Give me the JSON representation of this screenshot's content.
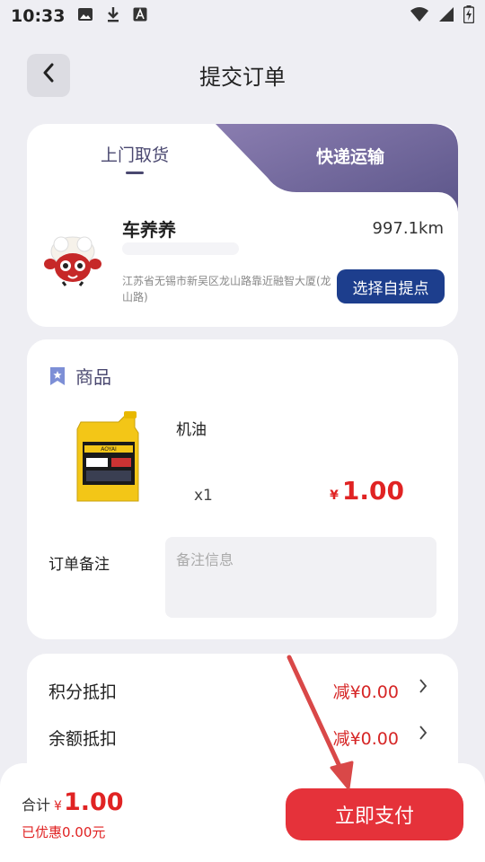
{
  "status": {
    "time": "10:33"
  },
  "header": {
    "title": "提交订单"
  },
  "delivery": {
    "tab_pickup": "上门取货",
    "tab_express": "快递运输",
    "store_name": "车养养",
    "distance": "997.1km",
    "address": "江苏省无锡市新吴区龙山路靠近融智大厦(龙山路)",
    "select_button": "选择自提点",
    "active_tab_color": "#6f6496"
  },
  "goods": {
    "section_title": "商品",
    "item_name": "机油",
    "quantity": "x1",
    "currency": "¥",
    "price": "1.00",
    "remark_label": "订单备注",
    "remark_placeholder": "备注信息"
  },
  "deductions": [
    {
      "label": "积分抵扣",
      "value": "减¥0.00"
    },
    {
      "label": "余额抵扣",
      "value": "减¥0.00"
    }
  ],
  "footer": {
    "total_label": "合计",
    "currency": "¥",
    "total": "1.00",
    "discount": "已优惠0.00元",
    "pay_button": "立即支付",
    "pay_color": "#e5323a"
  }
}
